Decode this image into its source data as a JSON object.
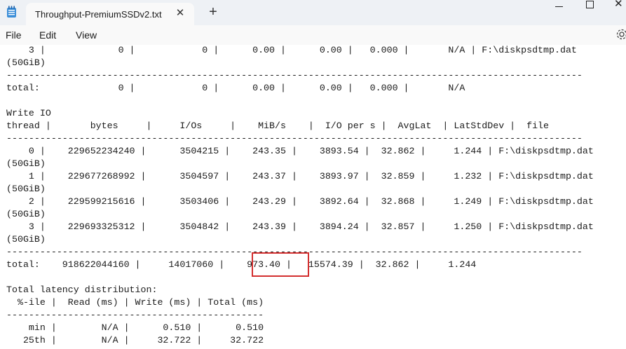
{
  "window": {
    "tab_title": "Throughput-PremiumSSDv2.txt",
    "close_glyph": "✕",
    "new_tab_glyph": "+"
  },
  "menu": {
    "file": "File",
    "edit": "Edit",
    "view": "View"
  },
  "icons": {
    "app": "notepad-icon",
    "settings": "gear-icon"
  },
  "highlight_color": "#d32f2f",
  "document": {
    "lines": [
      "    3 |             0 |            0 |      0.00 |      0.00 |   0.000 |       N/A | F:\\diskpsdtmp.dat",
      "(50GiB)",
      "-------------------------------------------------------------------------------------------------------",
      "total:              0 |            0 |      0.00 |      0.00 |   0.000 |       N/A",
      "",
      "Write IO",
      "thread |       bytes     |     I/Os     |    MiB/s    |  I/O per s |  AvgLat  | LatStdDev |  file",
      "-------------------------------------------------------------------------------------------------------",
      "    0 |    229652234240 |      3504215 |    243.35 |    3893.54 |  32.862 |     1.244 | F:\\diskpsdtmp.dat",
      "(50GiB)",
      "    1 |    229677268992 |      3504597 |    243.37 |    3893.97 |  32.859 |     1.232 | F:\\diskpsdtmp.dat",
      "(50GiB)",
      "    2 |    229599215616 |      3503406 |    243.29 |    3892.64 |  32.868 |     1.249 | F:\\diskpsdtmp.dat",
      "(50GiB)",
      "    3 |    229693325312 |      3504842 |    243.39 |    3894.24 |  32.857 |     1.250 | F:\\diskpsdtmp.dat",
      "(50GiB)",
      "-------------------------------------------------------------------------------------------------------",
      "total:    918622044160 |     14017060 |    973.40 |   15574.39 |  32.862 |     1.244",
      "",
      "Total latency distribution:",
      "  %-ile |  Read (ms) | Write (ms) | Total (ms)",
      "----------------------------------------------",
      "    min |        N/A |      0.510 |      0.510",
      "   25th |        N/A |     32.722 |     32.722"
    ]
  }
}
